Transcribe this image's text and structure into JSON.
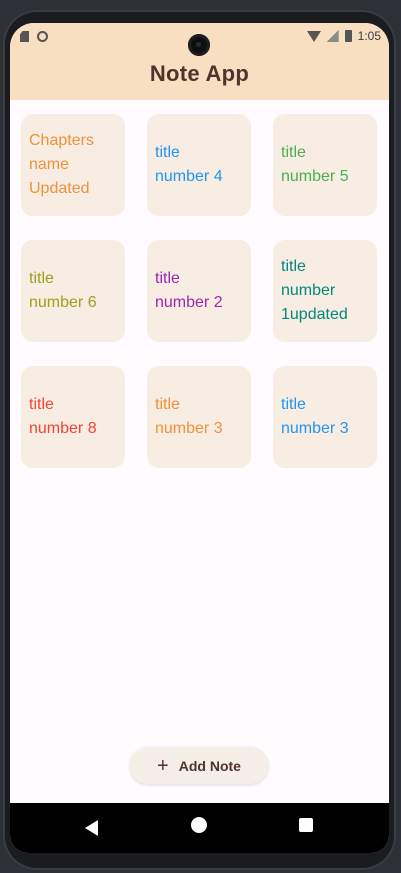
{
  "status_bar": {
    "time": "1:05",
    "icons": [
      "sd-card-icon",
      "circle-icon",
      "wifi-icon",
      "signal-icon",
      "battery-icon"
    ]
  },
  "app_bar": {
    "title": "Note App",
    "background": "#f8dfc1",
    "title_color": "#4e342e"
  },
  "notes": [
    {
      "text": "Chapters\nname\nUpdated",
      "color": "#f0913a"
    },
    {
      "text": "title\nnumber 4",
      "color": "#2196f3"
    },
    {
      "text": "title\nnumber 5",
      "color": "#4caf50"
    },
    {
      "text": "title\nnumber 6",
      "color": "#a49b1c"
    },
    {
      "text": "title\nnumber 2",
      "color": "#9c27b0"
    },
    {
      "text": "title\nnumber\n1updated",
      "color": "#00897b"
    },
    {
      "text": "title\nnumber 8",
      "color": "#f44336"
    },
    {
      "text": "title\nnumber 3",
      "color": "#f0913a"
    },
    {
      "text": "title\nnumber 3",
      "color": "#2196f3"
    }
  ],
  "add_button": {
    "label": "Add Note",
    "icon": "plus-icon"
  },
  "nav_bar": {
    "icons": [
      "back-icon",
      "home-icon",
      "recents-icon"
    ]
  }
}
